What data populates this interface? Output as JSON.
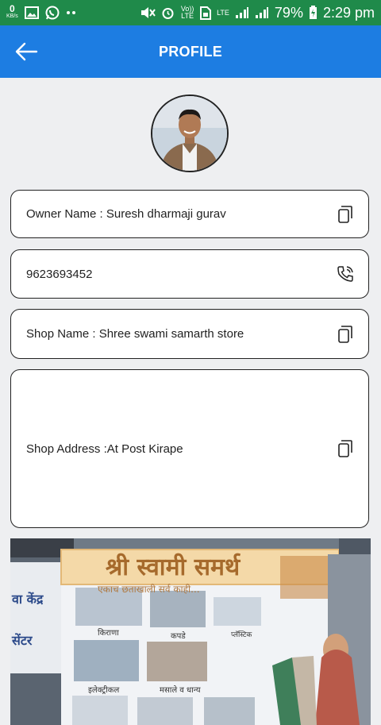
{
  "status_bar": {
    "speed_value": "0",
    "speed_unit": "KB/s",
    "volte": "Vo)) LTE",
    "lte": "LTE",
    "battery": "79%",
    "time": "2:29 pm"
  },
  "header": {
    "title": "PROFILE"
  },
  "profile": {
    "owner": "Owner Name : Suresh dharmaji gurav",
    "phone": "9623693452",
    "shop_name": "Shop Name : Shree swami samarth store",
    "shop_address": "Shop Address :At Post Kirape"
  },
  "shop_photo": {
    "sign_title": "श्री स्वामी समर्थ",
    "sign_tagline": "एकाच छताखाली सर्व काही...",
    "categories": [
      "किराणा",
      "कपडे",
      "प्लॅस्टिक",
      "इलेक्ट्रीकल",
      "मसाले व धान्य"
    ],
    "side_text_1": "वा केंद्र",
    "side_text_2": "सेंटर"
  },
  "colors": {
    "status_bar": "#1f8a4a",
    "header": "#1d7de2",
    "background": "#eeeff1"
  },
  "icons": [
    "back-arrow-icon",
    "copy-icon",
    "phone-call-icon"
  ]
}
